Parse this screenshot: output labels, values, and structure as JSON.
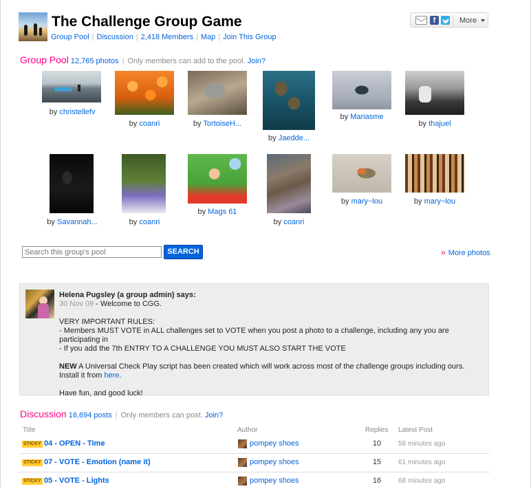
{
  "header": {
    "title": "The Challenge Group Game",
    "nav": [
      "Group Pool",
      "Discussion",
      "2,418 Members",
      "Map",
      "Join This Group"
    ],
    "share_more_label": "More"
  },
  "pool": {
    "heading": "Group Pool",
    "count": "12,765 photos",
    "note": "Only members can add to the pool.",
    "join": "Join?",
    "photos": [
      {
        "by": "by",
        "author": "christellefv"
      },
      {
        "by": "by",
        "author": "coanri"
      },
      {
        "by": "by",
        "author": "TortoiseH..."
      },
      {
        "by": "by",
        "author": "Jaedde..."
      },
      {
        "by": "by",
        "author": "Mariasme"
      },
      {
        "by": "by",
        "author": "thajuel"
      },
      {
        "by": "by",
        "author": "Savannah..."
      },
      {
        "by": "by",
        "author": "coanri"
      },
      {
        "by": "by",
        "author": "Mags 61"
      },
      {
        "by": "by",
        "author": "coanri"
      },
      {
        "by": "by",
        "author": "mary~lou"
      },
      {
        "by": "by",
        "author": "mary~lou"
      }
    ],
    "search_placeholder": "Search this group's pool",
    "search_button": "SEARCH",
    "more_photos": "More photos"
  },
  "admin_notice": {
    "author": "Helena Pugsley (a group admin) says:",
    "date": "30 Nov 09",
    "greeting": " - Welcome to CGG.",
    "rules_heading": "VERY IMPORTANT RULES:",
    "rule1": "- Members MUST VOTE in ALL challenges set to VOTE when you post a photo to a challenge, including any you are participating in",
    "rule2": "- If you add the 7th ENTRY TO A CHALLENGE YOU MUST ALSO START THE VOTE",
    "new_label": "NEW",
    "new_text": " A Universal Check Play script has been created which will work across most of the challenge groups including ours. Install it from ",
    "here_link": "here",
    "new_end": ".",
    "signoff": "Have fun, and good luck!"
  },
  "discussion": {
    "heading": "Discussion",
    "count": "16,694 posts",
    "note": "Only members can post.",
    "join": "Join?",
    "columns": {
      "title": "Title",
      "author": "Author",
      "replies": "Replies",
      "latest": "Latest Post"
    },
    "rows": [
      {
        "badge": "STICKY",
        "title": "04 - OPEN - Time",
        "author": "pompey shoes",
        "replies": "10",
        "latest": "58 minutes ago"
      },
      {
        "badge": "STICKY",
        "title": "07 - VOTE - Emotion (name it)",
        "author": "pompey shoes",
        "replies": "15",
        "latest": "61 minutes ago"
      },
      {
        "badge": "STICKY",
        "title": "05 - VOTE - Lights",
        "author": "pompey shoes",
        "replies": "16",
        "latest": "68 minutes ago"
      }
    ]
  }
}
